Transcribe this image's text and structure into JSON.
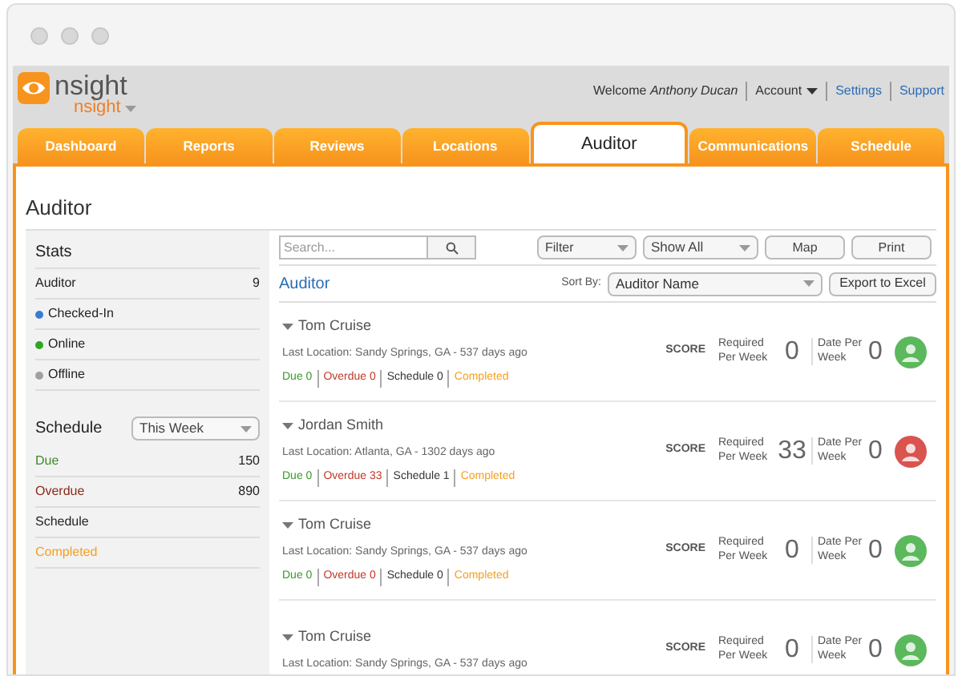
{
  "app": {
    "logo_text": "nsight",
    "product_menu": "nsight"
  },
  "user_bar": {
    "welcome": "Welcome",
    "user_name": "Anthony Ducan",
    "links": [
      {
        "label": "Account",
        "kind": "menu"
      },
      {
        "label": "Settings",
        "kind": "link"
      },
      {
        "label": "Support",
        "kind": "link"
      }
    ]
  },
  "tabs": [
    {
      "label": "Dashboard",
      "selected": false
    },
    {
      "label": "Reports",
      "selected": false
    },
    {
      "label": "Reviews",
      "selected": false
    },
    {
      "label": "Locations",
      "selected": false
    },
    {
      "label": "Auditor",
      "selected": true
    },
    {
      "label": "Communications",
      "selected": false
    },
    {
      "label": "Schedule",
      "selected": false
    }
  ],
  "page_title": "Auditor",
  "sidebar": {
    "stats_title": "Stats",
    "stats": [
      {
        "label": "Auditor",
        "value": "9"
      },
      {
        "label": "Checked-In",
        "color": "#3a7bd5"
      },
      {
        "label": "Online",
        "color": "#2ea820"
      },
      {
        "label": "Offline",
        "color": "#a0a0a0"
      }
    ],
    "schedule_title": "Schedule",
    "schedule_period": "This Week",
    "schedule": [
      {
        "label": "Due",
        "value": "150",
        "color": "#3a8a2a"
      },
      {
        "label": "Overdue",
        "value": "890",
        "color": "#8a2a1a"
      },
      {
        "label": "Schedule",
        "color": "#222222"
      },
      {
        "label": "Completed",
        "color": "#f5a020"
      }
    ]
  },
  "toolbar": {
    "search_placeholder": "Search...",
    "filter": "Filter",
    "show": "Show All",
    "buttons": [
      "Map",
      "Print"
    ]
  },
  "list": {
    "title": "Auditor",
    "sort_label": "Sort By:",
    "sort_value": "Auditor Name",
    "export": "Export to Excel",
    "rows": [
      {
        "name": "Tom Cruise",
        "location": "Last Location: Sandy Springs, GA - 537 days ago",
        "counts": [
          "Due 0",
          "Overdue 0",
          "Schedule 0",
          "Completed"
        ],
        "score": "SCORE",
        "required_label": "Required Per Week",
        "required": "0",
        "done_label": "Date Per Week",
        "done": "0",
        "color": "#5cb85c"
      },
      {
        "name": "Jordan Smith",
        "location": "Last Location: Atlanta, GA - 1302 days ago",
        "counts": [
          "Due 0",
          "Overdue 33",
          "Schedule 1",
          "Completed"
        ],
        "score": "SCORE",
        "required_label": "Required Per Week",
        "required": "33",
        "done_label": "Date Per Week",
        "done": "0",
        "color": "#d9534f"
      },
      {
        "name": "Tom Cruise",
        "location": "Last Location: Sandy Springs, GA - 537 days ago",
        "counts": [
          "Due 0",
          "Overdue 0",
          "Schedule 0",
          "Completed"
        ],
        "score": "SCORE",
        "required_label": "Required Per Week",
        "required": "0",
        "done_label": "Date Per Week",
        "done": "0",
        "color": "#5cb85c"
      },
      {
        "name": "Tom Cruise",
        "location": "Last Location: Sandy Springs, GA - 537 days ago",
        "score": "SCORE",
        "required_label": "Required Per Week",
        "required": "0",
        "done_label": "Date Per Week",
        "done": "0",
        "color": "#5cb85c"
      }
    ]
  }
}
